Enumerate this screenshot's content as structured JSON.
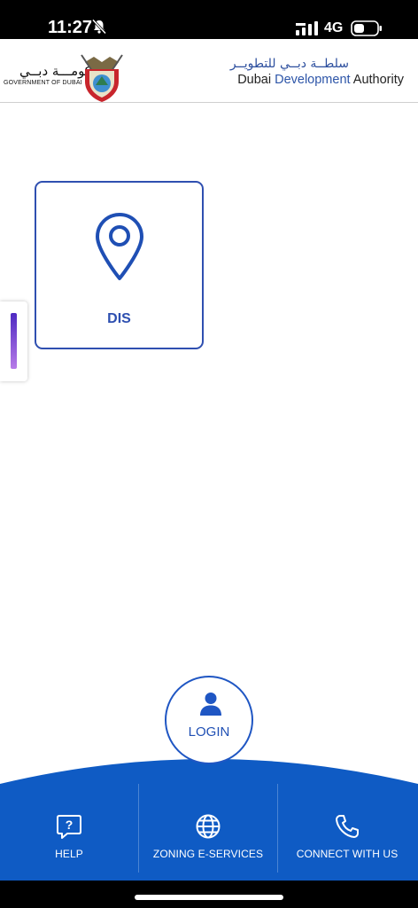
{
  "status_bar": {
    "time": "11:27",
    "network": "4G",
    "icons": [
      "bell-slash-icon",
      "signal-icon",
      "battery-icon"
    ]
  },
  "header": {
    "gov_logo": {
      "arabic": "حكومـــة دبــي",
      "english": "GOVERNMENT OF DUBAI"
    },
    "dda_logo": {
      "arabic": "سلطــة دبــي للتطويــر",
      "english_part1": "Dubai ",
      "english_part2": "Development",
      "english_part3": " Authority"
    }
  },
  "tiles": [
    {
      "label": "DIS",
      "icon": "map-pin-icon"
    }
  ],
  "login": {
    "label": "LOGIN",
    "icon": "user-icon"
  },
  "bottom_nav": {
    "items": [
      {
        "label": "HELP",
        "icon": "help-icon"
      },
      {
        "label": "ZONING E-SERVICES",
        "icon": "globe-icon"
      },
      {
        "label": "CONNECT WITH US",
        "icon": "phone-icon"
      }
    ]
  },
  "colors": {
    "primary": "#1f5fc8",
    "tile_border": "#2f4fb0",
    "handle_gradient_top": "#4e2ac2",
    "handle_gradient_bottom": "#b77be8"
  }
}
